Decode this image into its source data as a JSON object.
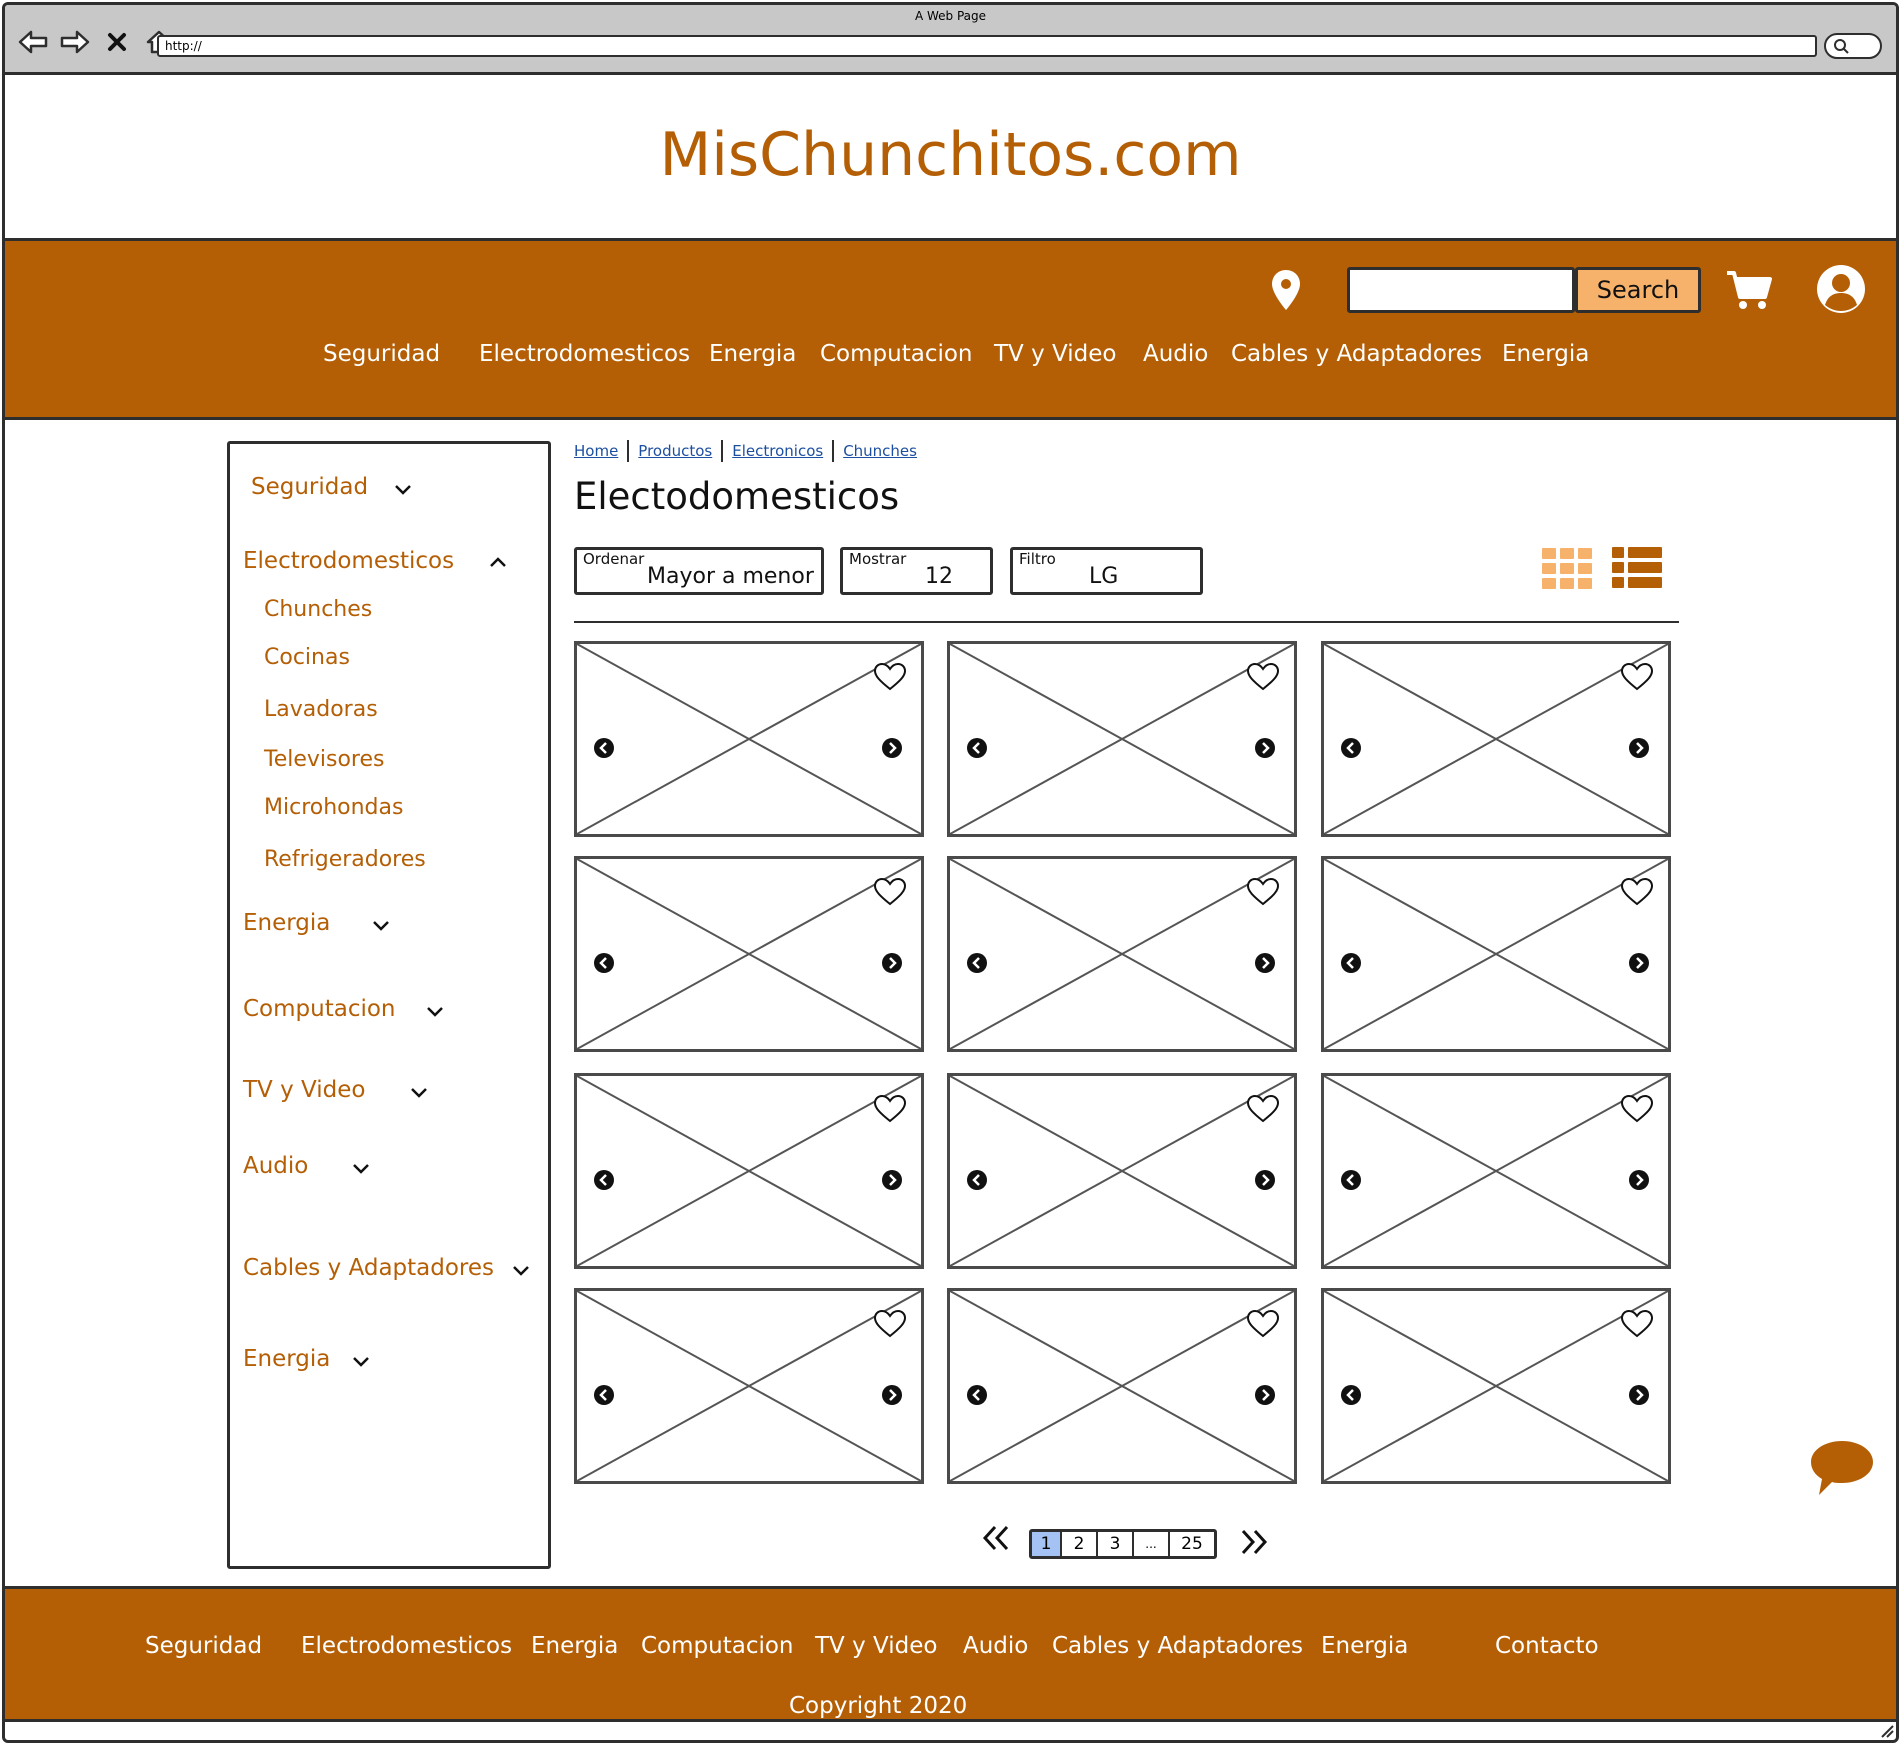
{
  "browser": {
    "title": "A Web Page",
    "url": "http://"
  },
  "site": {
    "logo": "MisChunchitos.com"
  },
  "header": {
    "search_value": "",
    "search_button": "Search",
    "menu": [
      "Seguridad",
      "Electrodomesticos",
      "Energia",
      "Computacion",
      "TV y Video",
      "Audio",
      "Cables y Adaptadores",
      "Energia"
    ]
  },
  "sidebar": {
    "items": [
      {
        "label": "Seguridad",
        "expanded": false
      },
      {
        "label": "Electrodomesticos",
        "expanded": true,
        "children": [
          "Chunches",
          "Cocinas",
          "Lavadoras",
          "Televisores",
          "Microhondas",
          "Refrigeradores"
        ]
      },
      {
        "label": "Energia",
        "expanded": false
      },
      {
        "label": "Computacion",
        "expanded": false
      },
      {
        "label": "TV y Video",
        "expanded": false
      },
      {
        "label": "Audio",
        "expanded": false
      },
      {
        "label": "Cables y Adaptadores",
        "expanded": false
      },
      {
        "label": "Energia",
        "expanded": false
      }
    ]
  },
  "breadcrumb": [
    "Home",
    "Productos",
    "Electronicos",
    "Chunches"
  ],
  "page_title": "Electodomesticos",
  "controls": {
    "order": {
      "label": "Ordenar",
      "value": "Mayor a menor"
    },
    "show": {
      "label": "Mostrar",
      "value": "12"
    },
    "filter": {
      "label": "Filtro",
      "value": "LG"
    }
  },
  "colors": {
    "brand": "#b45f06",
    "accent": "#f6b26b",
    "pager_active": "#a4c2f4"
  },
  "pagination": {
    "pages": [
      "1",
      "2",
      "3",
      "...",
      "25"
    ],
    "current": "1"
  },
  "footer": {
    "links": [
      "Seguridad",
      "Electrodomesticos",
      "Energia",
      "Computacion",
      "TV y Video",
      "Audio",
      "Cables y Adaptadores",
      "Energia",
      "Contacto"
    ],
    "copyright": "Copyright 2020"
  }
}
